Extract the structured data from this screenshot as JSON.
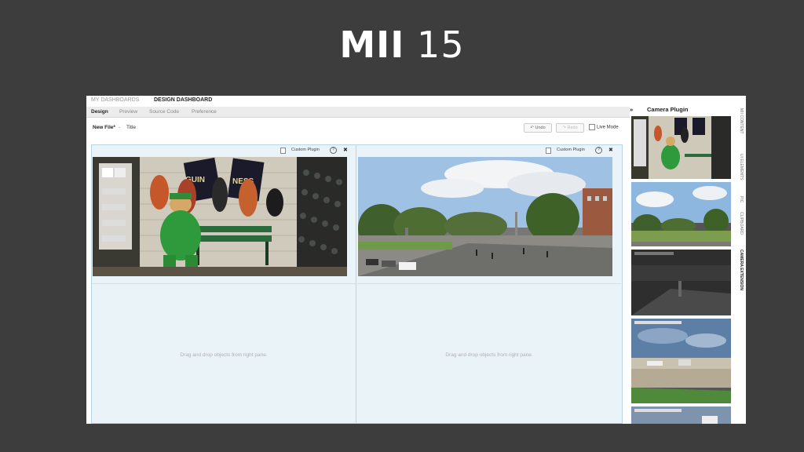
{
  "slide": {
    "title_bold": "MII",
    "title_num": "15"
  },
  "app": {
    "top_tabs": [
      "MY DASHBOARDS",
      "DESIGN DASHBOARD"
    ],
    "sub_tabs": [
      "Design",
      "Preview",
      "Source Code",
      "Preference"
    ],
    "file_name": "New File*",
    "file_sep": "-",
    "file_title": "Title",
    "undo_label": "Undo",
    "redo_label": "Redo",
    "live_mode_label": "Live Mode",
    "widgets": [
      {
        "label": "Custom Plugin",
        "drop_text": "Drag and drop objects from right pane."
      },
      {
        "label": "Custom Plugin",
        "drop_text": "Drag and drop objects from right pane."
      }
    ],
    "right_panel": {
      "title": "Camera Plugin",
      "vertical_tabs": [
        "MII CONTENT",
        "UI ELEMENTS",
        "PIC",
        "CLIPBOARD",
        "CAMERA EXTENSION"
      ],
      "active_tab": "CAMERA EXTENSION"
    }
  },
  "colors": {
    "background": "#3d3d3d",
    "workspace": "#eaf3f8",
    "border": "#b7d6e3"
  }
}
